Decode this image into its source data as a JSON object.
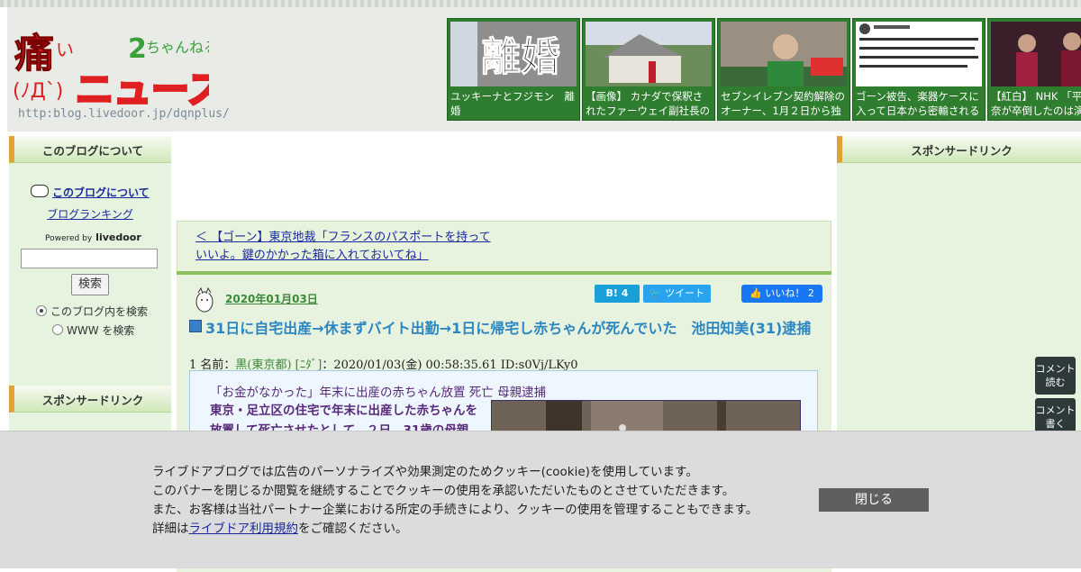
{
  "header": {
    "logo_url_text": "http:blog.livedoor.jp/dqnplus/",
    "thumbnails": [
      {
        "caption": "ユッキーナとフジモン　離婚"
      },
      {
        "caption": "【画像】 カナダで保釈されたファーウェイ副社長の足"
      },
      {
        "caption": "セブンイレブン契約解除のオーナー、1月２日から独"
      },
      {
        "caption": "ゴーン被告、楽器ケースに入って日本から密輸される"
      },
      {
        "caption": "【紅白】 NHK 「平手友梨奈が卒倒したのは演"
      }
    ]
  },
  "left_sidebar": {
    "about_heading": "このブログについて",
    "about_link": "このブログについて",
    "ranking_link": "ブログランキング",
    "powered_by": "Powered by",
    "livedoor": "livedoor",
    "search_button": "検索",
    "radio_blog": "このブログ内を検索",
    "radio_www": "WWW を検索",
    "sponsor_heading": "スポンサードリンク"
  },
  "center": {
    "prev_link": "＜ 【ゴーン】東京地裁「フランスのパスポートを持っていいよ。鍵のかかった箱に入れておいてね」",
    "date": "2020年01月03日",
    "hatena_count": "B! 4",
    "tweet_label": "ツイート",
    "like_label": "いいね！ 2",
    "title": "31日に自宅出産→休まずバイト出勤→1日に帰宅し赤ちゃんが死んでいた　池田知美(31)逮捕",
    "post_number": "1 名前：",
    "post_name": "黒(東京都) [ﾆﾀﾞ]",
    "post_meta": "：2020/01/03(金) 00:58:35.61 ID:s0Vj/LKy0",
    "quote_line1": "「お金がなかった」年末に出産の赤ちゃん放置 死亡 母親逮捕",
    "quote_line2": "東京・足立区の住宅で年末に出産した赤ちゃんを放置して死亡させたとして、２日、31歳の母親"
  },
  "right_sidebar": {
    "sponsor_heading": "スポンサードリンク"
  },
  "floating": {
    "read_comments": "コメント読む",
    "write_comments": "コメント書く"
  },
  "cookie_banner": {
    "line1": "ライブドアブログでは広告のパーソナライズや効果測定のためクッキー(cookie)を使用しています。",
    "line2": "このバナーを閉じるか閲覧を継続することでクッキーの使用を承認いただいたものとさせていただきます。",
    "line3": "また、お客様は当社パートナー企業における所定の手続きにより、クッキーの使用を管理することもできます。",
    "line4_prefix": "詳細は",
    "line4_link": "ライブドア利用規約",
    "line4_suffix": "をご確認ください。",
    "close_button": "閉じる"
  }
}
